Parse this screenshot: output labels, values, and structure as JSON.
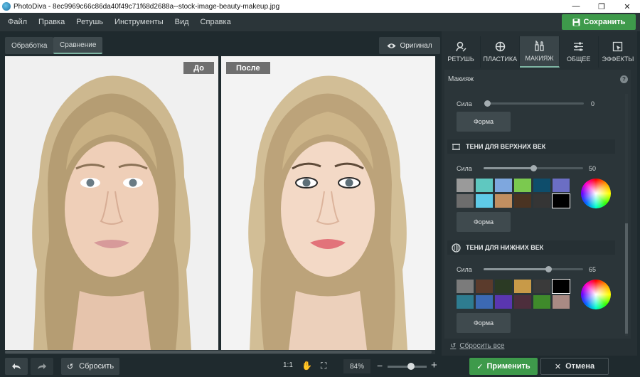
{
  "window": {
    "title": "PhotoDiva - 8ec9969c66c86da40f49c71f68d2688a--stock-image-beauty-makeup.jpg",
    "controls": [
      "—",
      "❐",
      "✕"
    ]
  },
  "menu": {
    "items": [
      "Файл",
      "Правка",
      "Ретушь",
      "Инструменты",
      "Вид",
      "Справка"
    ],
    "save_label": "Сохранить"
  },
  "view_tabs": {
    "processing": "Обработка",
    "compare": "Сравнение",
    "original": "Оригинал"
  },
  "canvas": {
    "before_label": "До",
    "after_label": "После"
  },
  "bottom": {
    "reset_label": "Сбросить",
    "ratio_label": "1:1",
    "zoom_value": "84%",
    "zoom_level": 0.6,
    "apply_label": "Применить",
    "cancel_label": "Отмена"
  },
  "panel": {
    "tabs": [
      {
        "label": "РЕТУШЬ",
        "icon": "face-retouch-icon"
      },
      {
        "label": "ПЛАСТИКА",
        "icon": "plastic-target-icon"
      },
      {
        "label": "МАКИЯЖ",
        "icon": "makeup-brushes-icon"
      },
      {
        "label": "ОБЩЕЕ",
        "icon": "sliders-icon"
      },
      {
        "label": "ЭФФЕКТЫ",
        "icon": "effects-icon"
      }
    ],
    "section_title": "Макияж",
    "help": "?",
    "first": {
      "strength_label": "Сила",
      "strength_value": "0",
      "strength": 0,
      "form_label": "Форма"
    },
    "upper": {
      "header": "ТЕНИ ДЛЯ ВЕРХНИХ ВЕК",
      "strength_label": "Сила",
      "strength_value": "50",
      "strength": 50,
      "form_label": "Форма",
      "swatches": [
        "#9a9a9a",
        "#5fc8c0",
        "#7ea7de",
        "#7bc94f",
        "#0e4d6b",
        "#6b6ec4",
        "#6d6d6d",
        "#5fcbe8",
        "#c18f61",
        "#4a3322",
        "#353535",
        "#000000"
      ],
      "selected_index": 11
    },
    "lower": {
      "header": "ТЕНИ ДЛЯ НИЖНИХ ВЕК",
      "strength_label": "Сила",
      "strength_value": "65",
      "strength": 65,
      "form_label": "Форма",
      "swatches": [
        "#7b7b7b",
        "#5b3b2c",
        "#2b3a24",
        "#c89a48",
        "#3a3a3a",
        "#000000",
        "#2e7c90",
        "#3c69b4",
        "#5a36b0",
        "#4d2e3c",
        "#3f8a2b",
        "#a98a84"
      ],
      "selected_index": 5
    },
    "reset_all": "Сбросить все"
  },
  "colors": {
    "accent_green": "#3e9a4b",
    "panel_bg": "#263034"
  }
}
